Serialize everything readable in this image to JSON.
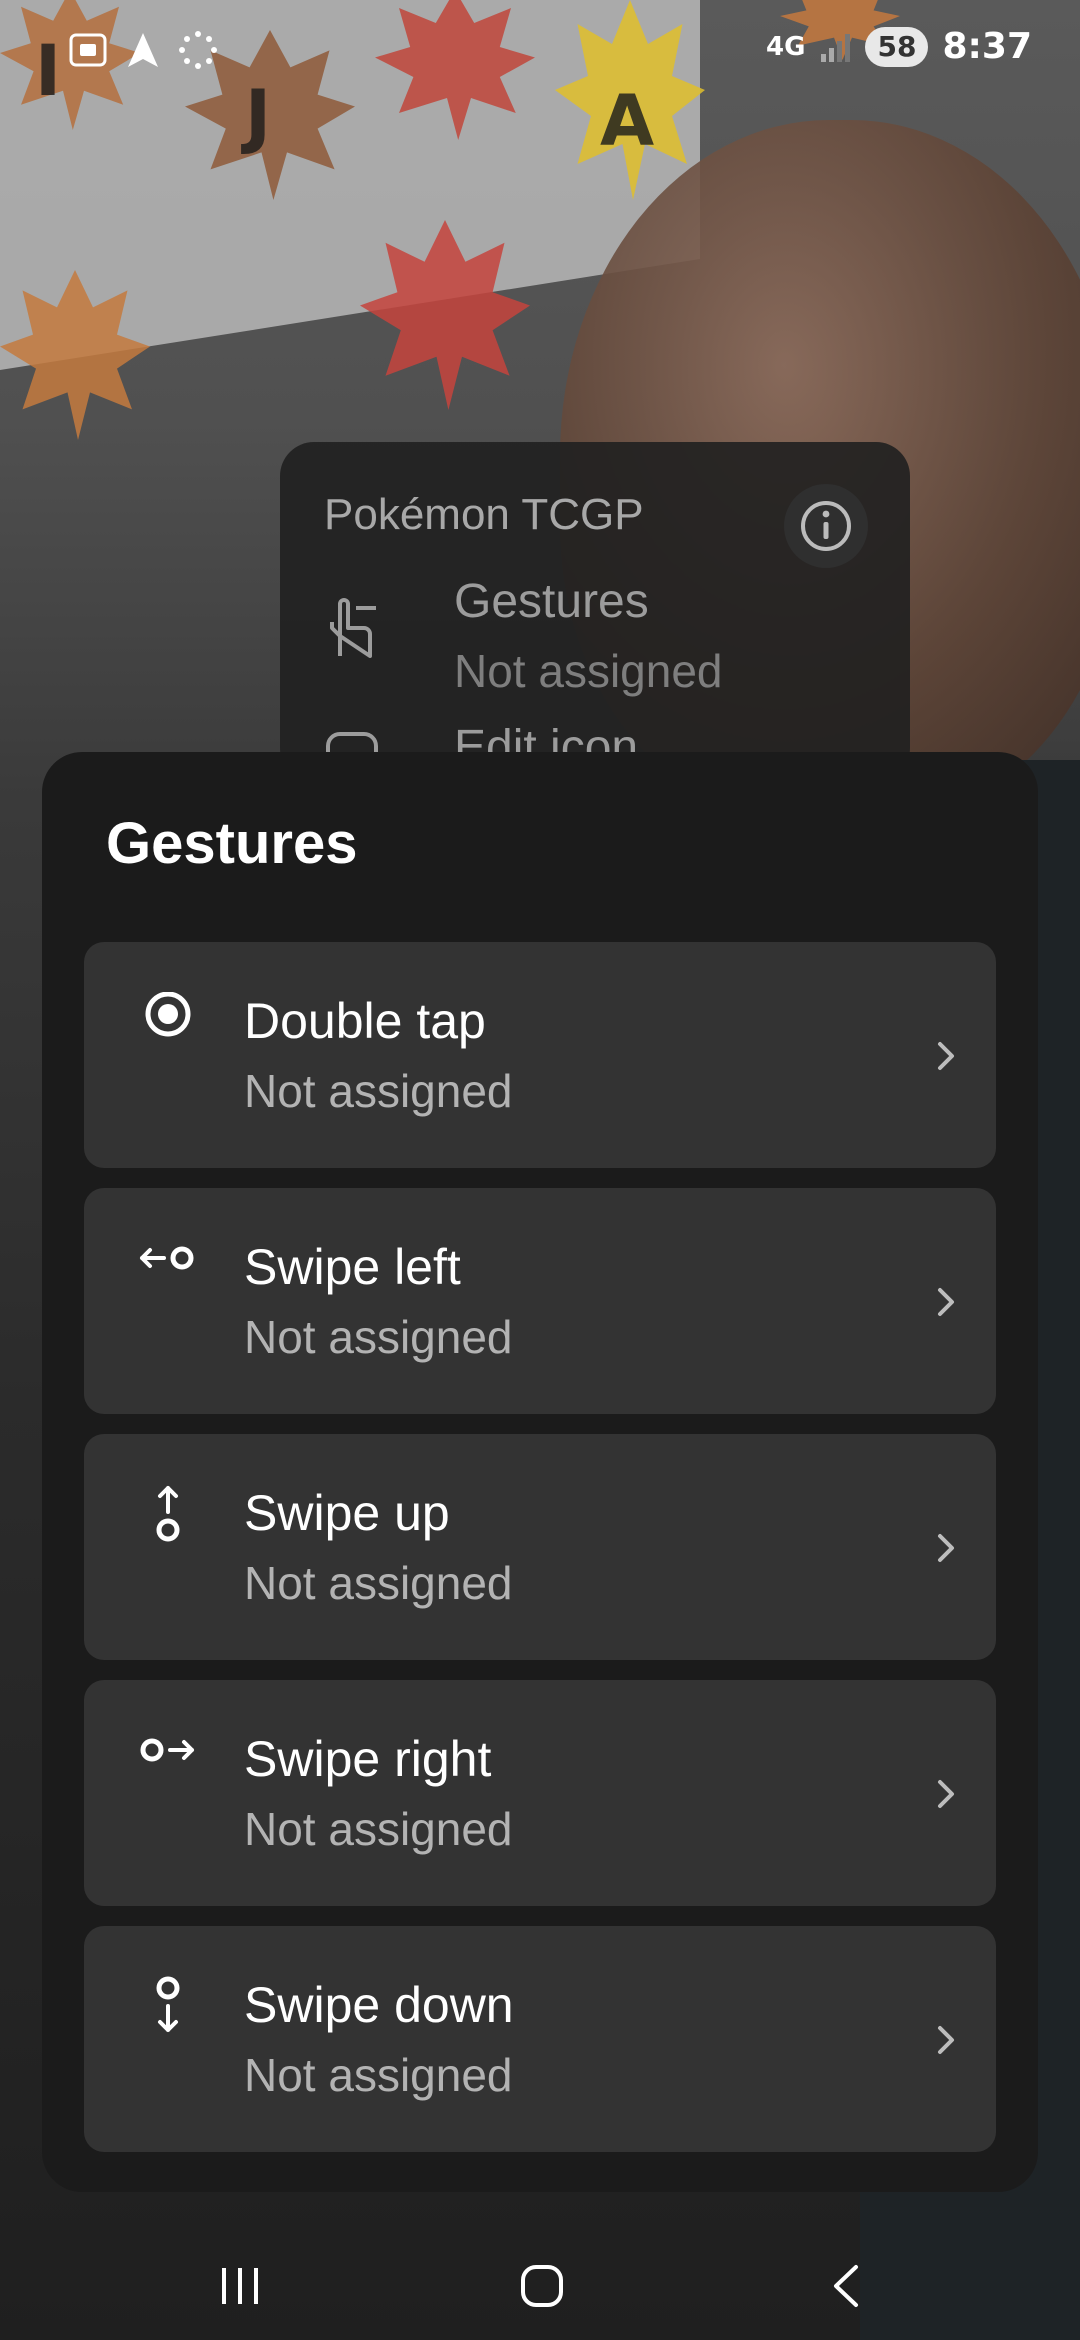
{
  "status_bar": {
    "network": "4G",
    "battery": "58",
    "time": "8:37"
  },
  "app_popup": {
    "title": "Pokémon TCGP",
    "items": [
      {
        "label": "Gestures",
        "value": "Not assigned",
        "icon": "hand-gesture-icon"
      },
      {
        "label": "Edit icon",
        "icon": "edit-icon-icon"
      }
    ]
  },
  "gestures_sheet": {
    "title": "Gestures",
    "options": [
      {
        "label": "Double tap",
        "value": "Not assigned",
        "icon": "double-tap-icon"
      },
      {
        "label": "Swipe left",
        "value": "Not assigned",
        "icon": "swipe-left-icon"
      },
      {
        "label": "Swipe up",
        "value": "Not assigned",
        "icon": "swipe-up-icon"
      },
      {
        "label": "Swipe right",
        "value": "Not assigned",
        "icon": "swipe-right-icon"
      },
      {
        "label": "Swipe down",
        "value": "Not assigned",
        "icon": "swipe-down-icon"
      }
    ]
  },
  "colors": {
    "sheet_bg": "#1b1b1b",
    "option_bg": "#333333",
    "text_primary": "#ffffff",
    "text_secondary": "#b3b3b3"
  }
}
